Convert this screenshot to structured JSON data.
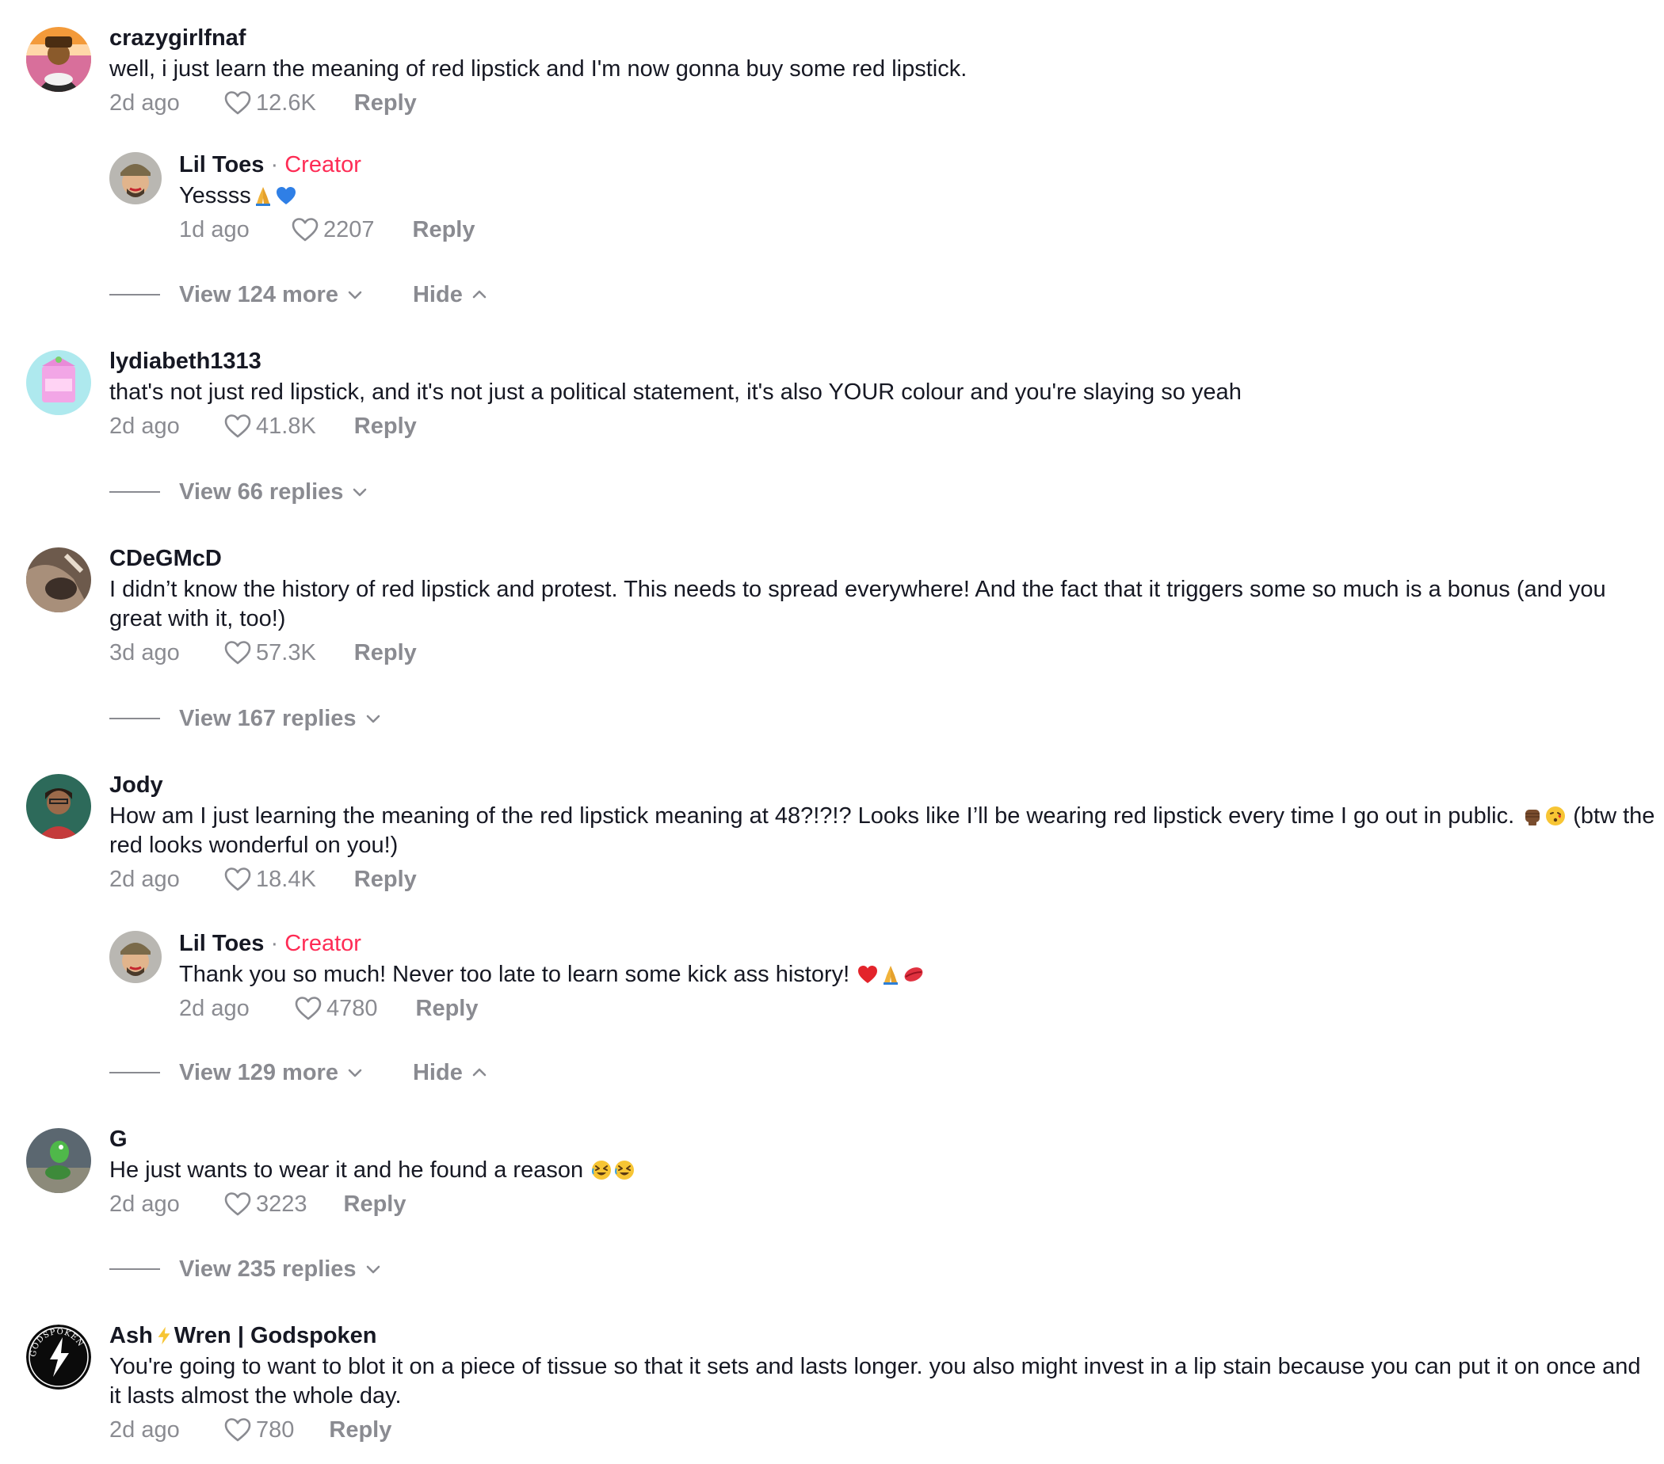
{
  "comments": [
    {
      "username": "crazygirlfnaf",
      "text": "well, i just learn the meaning of red lipstick and I'm now gonna buy some red lipstick.",
      "time": "2d ago",
      "likes": "12.6K",
      "reply_label": "Reply",
      "replies": [
        {
          "username": "Lil Toes",
          "separator": "·",
          "badge": "Creator",
          "text": "Yessss",
          "time": "1d ago",
          "likes": "2207",
          "reply_label": "Reply"
        }
      ],
      "thread": {
        "view_label": "View 124 more",
        "hide_label": "Hide"
      }
    },
    {
      "username": "lydiabeth1313",
      "text": "that's not just red lipstick, and it's not just a political statement, it's also YOUR colour and you're slaying so yeah",
      "time": "2d ago",
      "likes": "41.8K",
      "reply_label": "Reply",
      "thread": {
        "view_label": "View 66 replies"
      }
    },
    {
      "username": "CDeGMcD",
      "text": "I didn’t know the history of red lipstick and protest. This needs to spread everywhere! And the fact that it triggers some so much is a bonus (and you great with it, too!)",
      "time": "3d ago",
      "likes": "57.3K",
      "reply_label": "Reply",
      "thread": {
        "view_label": "View 167 replies"
      }
    },
    {
      "username": "Jody",
      "text_before": "How am I just learning the meaning of the red lipstick meaning at 48?!?!? Looks like I’ll be wearing red lipstick every time I go out in public.",
      "text_after": " (btw the red looks wonderful on you!)",
      "time": "2d ago",
      "likes": "18.4K",
      "reply_label": "Reply",
      "replies": [
        {
          "username": "Lil Toes",
          "separator": "·",
          "badge": "Creator",
          "text": "Thank you so much! Never too late to learn some kick ass history!",
          "time": "2d ago",
          "likes": "4780",
          "reply_label": "Reply"
        }
      ],
      "thread": {
        "view_label": "View 129 more",
        "hide_label": "Hide"
      }
    },
    {
      "username": "G",
      "text": "He just wants to wear it and he found a reason",
      "time": "2d ago",
      "likes": "3223",
      "reply_label": "Reply",
      "thread": {
        "view_label": "View 235 replies"
      }
    },
    {
      "username_part1": "Ash",
      "username_part2": "Wren | Godspoken",
      "text": "You're going to want to blot it on a piece of tissue so that it sets and lasts longer. you also might invest in a lip stain because you can put it on once and it lasts almost the whole day.",
      "time": "2d ago",
      "likes": "780",
      "reply_label": "Reply",
      "avatar_text": "GODSPOKEN"
    }
  ],
  "colors": {
    "text": "#161823",
    "secondary": "#8a8b91",
    "creator": "#fe2c55"
  }
}
